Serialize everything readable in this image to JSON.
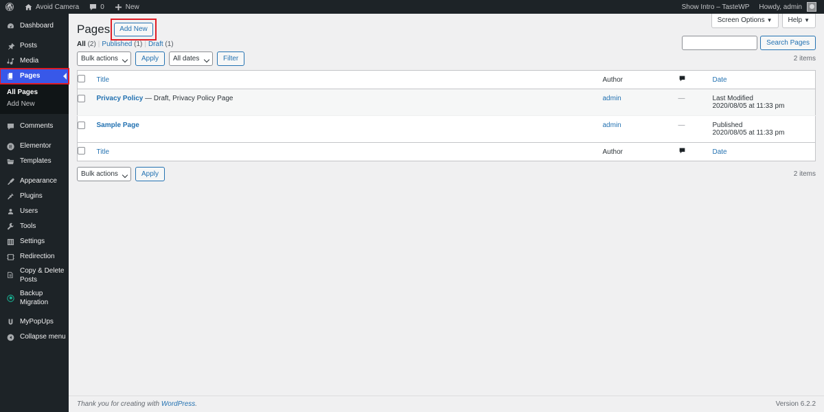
{
  "adminbar": {
    "left": [
      {
        "name": "wp-logo",
        "icon": "wordpress-icon",
        "label": ""
      },
      {
        "name": "site-name",
        "icon": "home-icon",
        "label": "Avoid Camera"
      },
      {
        "name": "comments",
        "icon": "comment-bubble-icon",
        "label": "0"
      },
      {
        "name": "new-content",
        "icon": "plus-icon",
        "label": "New"
      }
    ],
    "right": [
      {
        "name": "show-intro",
        "label": "Show Intro – TasteWP"
      },
      {
        "name": "my-account",
        "label": "Howdy, admin"
      }
    ]
  },
  "sidebar": {
    "items": [
      {
        "label": "Dashboard",
        "icon": "dashboard-icon",
        "current": false
      },
      {
        "label": "Posts",
        "icon": "pin-icon",
        "current": false
      },
      {
        "label": "Media",
        "icon": "media-icon",
        "current": false
      },
      {
        "label": "Pages",
        "icon": "pages-icon",
        "current": true,
        "highlighted": true
      },
      {
        "label": "Comments",
        "icon": "comment-bubble-icon",
        "current": false
      },
      {
        "label": "Elementor",
        "icon": "elementor-icon",
        "current": false
      },
      {
        "label": "Templates",
        "icon": "templates-icon",
        "current": false
      },
      {
        "label": "Appearance",
        "icon": "brush-icon",
        "current": false
      },
      {
        "label": "Plugins",
        "icon": "plug-icon",
        "current": false
      },
      {
        "label": "Users",
        "icon": "users-icon",
        "current": false
      },
      {
        "label": "Tools",
        "icon": "wrench-icon",
        "current": false
      },
      {
        "label": "Settings",
        "icon": "settings-sliders-icon",
        "current": false
      },
      {
        "label": "Redirection",
        "icon": "redirection-icon",
        "current": false
      },
      {
        "label": "Copy & Delete Posts",
        "icon": "copy-icon",
        "current": false
      },
      {
        "label": "Backup Migration",
        "icon": "backup-icon",
        "current": false
      },
      {
        "label": "MyPopUps",
        "icon": "magnet-icon",
        "current": false
      },
      {
        "label": "Collapse menu",
        "icon": "collapse-icon",
        "current": false
      }
    ],
    "submenu": [
      {
        "label": "All Pages",
        "current": true
      },
      {
        "label": "Add New",
        "current": false
      }
    ]
  },
  "screen_meta": {
    "screen_options": "Screen Options",
    "help": "Help",
    "caret": "▼"
  },
  "header": {
    "title": "Pages",
    "add_new": "Add New"
  },
  "search": {
    "value": "",
    "placeholder": "",
    "button": "Search Pages"
  },
  "views": {
    "all_label": "All",
    "all_count": "(2)",
    "published_label": "Published",
    "published_count": "(1)",
    "draft_label": "Draft",
    "draft_count": "(1)",
    "separator": "|"
  },
  "tablenav_top": {
    "bulk_actions": "Bulk actions",
    "apply": "Apply",
    "all_dates": "All dates",
    "filter": "Filter",
    "displaying_num": "2 items"
  },
  "tablenav_bottom": {
    "bulk_actions": "Bulk actions",
    "apply": "Apply",
    "displaying_num": "2 items"
  },
  "table": {
    "columns": {
      "title": "Title",
      "author": "Author",
      "comments": "comment-bubble-icon",
      "date": "Date"
    },
    "rows": [
      {
        "title": "Privacy Policy",
        "state": "— Draft, Privacy Policy Page",
        "author": "admin",
        "comments": "—",
        "date_label": "Last Modified",
        "date_value": "2020/08/05 at 11:33 pm"
      },
      {
        "title": "Sample Page",
        "state": "",
        "author": "admin",
        "comments": "—",
        "date_label": "Published",
        "date_value": "2020/08/05 at 11:33 pm"
      }
    ]
  },
  "footer": {
    "thanks_prefix": "Thank you for creating with ",
    "wordpress_link": "WordPress",
    "thanks_suffix": ".",
    "version": "Version 6.2.2"
  },
  "colors": {
    "admin_bar": "#1d2327",
    "sidebar": "#1d2327",
    "current_menu": "#3858e9",
    "link": "#2271b1",
    "highlight_red": "#e01b24",
    "content_bg": "#f0f0f1"
  }
}
